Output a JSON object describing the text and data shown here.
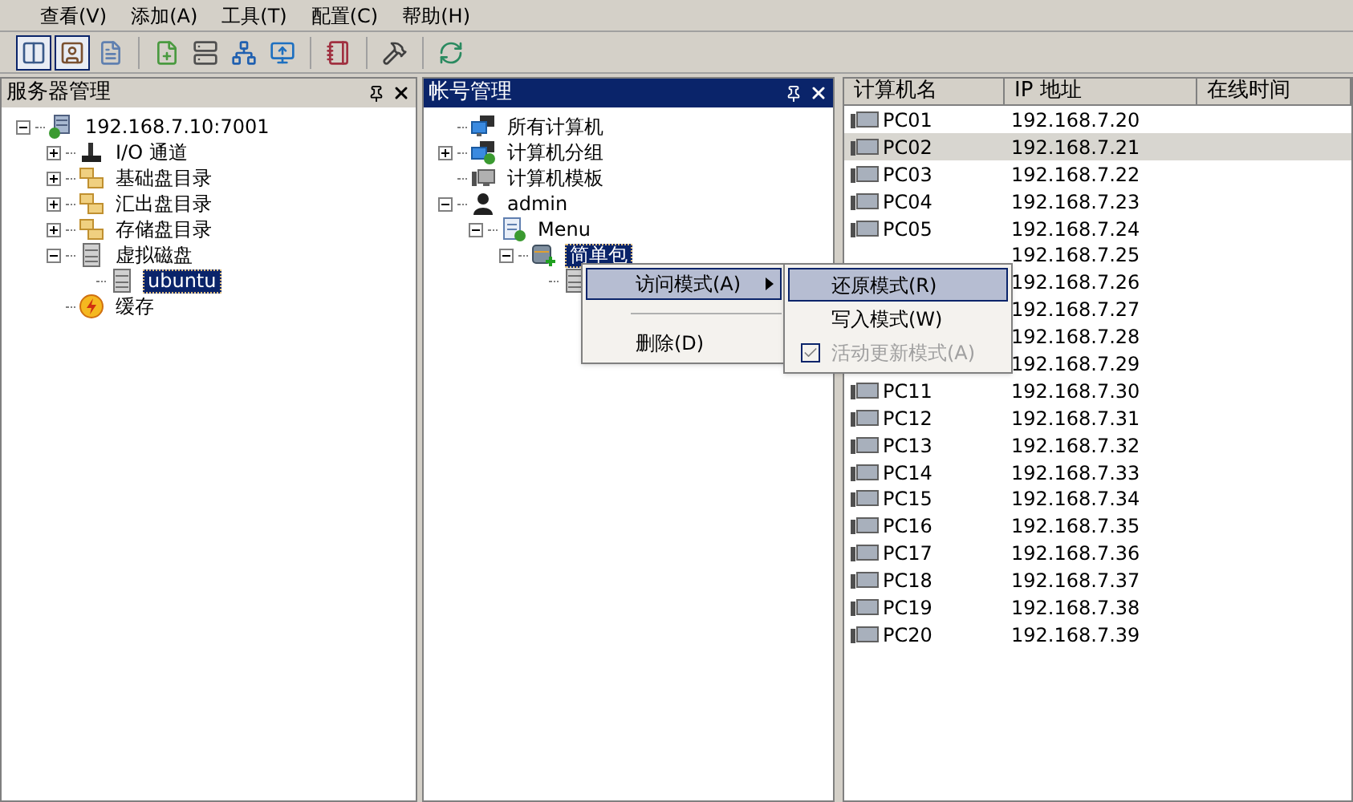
{
  "menu_bar": [
    "查看(V)",
    "添加(A)",
    "工具(T)",
    "配置(C)",
    "帮助(H)"
  ],
  "toolbar": [
    [
      {
        "kind": "panels",
        "pressed": true
      },
      {
        "kind": "user-card",
        "pressed": true
      },
      {
        "kind": "document",
        "pressed": false
      }
    ],
    [
      {
        "kind": "file-add",
        "pressed": false
      },
      {
        "kind": "server-add",
        "pressed": false
      },
      {
        "kind": "network-add",
        "pressed": false
      },
      {
        "kind": "monitor-add",
        "pressed": false
      }
    ],
    [
      {
        "kind": "notebook",
        "pressed": false
      }
    ],
    [
      {
        "kind": "tools",
        "pressed": false
      }
    ],
    [
      {
        "kind": "refresh",
        "pressed": false
      }
    ]
  ],
  "server_panel": {
    "title": "服务器管理",
    "active": false,
    "tree": [
      {
        "label": "192.168.7.10:7001",
        "kind": "server",
        "expanded": true,
        "selected": false,
        "children": [
          {
            "label": "I/O 通道",
            "kind": "io",
            "expanded": false,
            "selected": false
          },
          {
            "label": "基础盘目录",
            "kind": "folder",
            "expanded": false,
            "selected": false
          },
          {
            "label": "汇出盘目录",
            "kind": "folder",
            "expanded": false,
            "selected": false
          },
          {
            "label": "存储盘目录",
            "kind": "folder",
            "expanded": false,
            "selected": false
          },
          {
            "label": "虚拟磁盘",
            "kind": "disk",
            "expanded": true,
            "selected": false,
            "children": [
              {
                "label": "ubuntu",
                "kind": "disk",
                "selected": true
              }
            ]
          },
          {
            "label": "缓存",
            "kind": "cache",
            "selected": false
          }
        ]
      }
    ]
  },
  "account_panel": {
    "title": "帐号管理",
    "active": true,
    "tree": [
      {
        "label": "所有计算机",
        "kind": "computers",
        "selected": false
      },
      {
        "label": "计算机分组",
        "kind": "group",
        "expanded": false,
        "selected": false
      },
      {
        "label": "计算机模板",
        "kind": "template",
        "selected": false
      },
      {
        "label": "admin",
        "kind": "user",
        "expanded": true,
        "selected": false,
        "children": [
          {
            "label": "Menu",
            "kind": "menu",
            "expanded": true,
            "selected": false,
            "children": [
              {
                "label": "简单包",
                "kind": "package",
                "expanded": true,
                "selected": true,
                "children": [
                  {
                    "kind": "disk"
                  }
                ]
              }
            ]
          }
        ]
      }
    ]
  },
  "computer_list": {
    "columns": [
      "计算机名",
      "IP 地址",
      "在线时间"
    ],
    "rows": [
      {
        "name": "PC01",
        "ip": "192.168.7.20",
        "selected": false
      },
      {
        "name": "PC02",
        "ip": "192.168.7.21",
        "selected": true
      },
      {
        "name": "PC03",
        "ip": "192.168.7.22",
        "selected": false
      },
      {
        "name": "PC04",
        "ip": "192.168.7.23",
        "selected": false
      },
      {
        "name": "PC05",
        "ip": "192.168.7.24",
        "selected": false
      },
      {
        "ip": "192.168.7.25",
        "selected": false
      },
      {
        "ip": "192.168.7.26",
        "selected": false
      },
      {
        "ip": "192.168.7.27",
        "selected": false
      },
      {
        "ip": "192.168.7.28",
        "selected": false
      },
      {
        "ip": "192.168.7.29",
        "selected": false
      },
      {
        "name": "PC11",
        "ip": "192.168.7.30",
        "selected": false
      },
      {
        "name": "PC12",
        "ip": "192.168.7.31",
        "selected": false
      },
      {
        "name": "PC13",
        "ip": "192.168.7.32",
        "selected": false
      },
      {
        "name": "PC14",
        "ip": "192.168.7.33",
        "selected": false
      },
      {
        "name": "PC15",
        "ip": "192.168.7.34",
        "selected": false
      },
      {
        "name": "PC16",
        "ip": "192.168.7.35",
        "selected": false
      },
      {
        "name": "PC17",
        "ip": "192.168.7.36",
        "selected": false
      },
      {
        "name": "PC18",
        "ip": "192.168.7.37",
        "selected": false
      },
      {
        "name": "PC19",
        "ip": "192.168.7.38",
        "selected": false
      },
      {
        "name": "PC20",
        "ip": "192.168.7.39",
        "selected": false
      }
    ]
  },
  "context_menu": {
    "items": [
      {
        "kind": "submenu",
        "label": "访问模式(A)",
        "selected": true
      },
      {
        "kind": "separator"
      },
      {
        "kind": "item",
        "label": "删除(D)",
        "selected": false
      }
    ]
  },
  "submenu": {
    "items": [
      {
        "label": "还原模式(R)",
        "selected": true,
        "checked": false,
        "disabled": false
      },
      {
        "label": "写入模式(W)",
        "selected": false,
        "checked": false,
        "disabled": false
      },
      {
        "label": "活动更新模式(A)",
        "selected": false,
        "checked": true,
        "disabled": true
      }
    ]
  }
}
